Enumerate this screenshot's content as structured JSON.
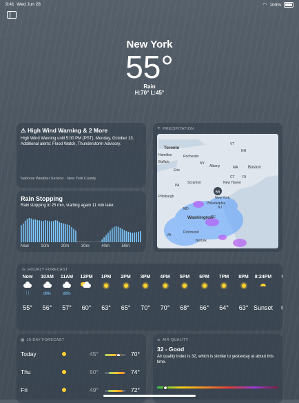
{
  "status": {
    "time": "9:41",
    "date": "Wed Jun 28",
    "battery": "100%"
  },
  "hero": {
    "city": "New York",
    "temp": "55°",
    "condition": "Rain",
    "hilo": "H:70°  L:45°"
  },
  "alert": {
    "title": "High Wind Warning & 2 More",
    "body": "High Wind Warning until 5:00 PM (PST), Monday, October 13. Additional alerts: Flood Watch, Thunderstorm Advisory.",
    "source": "National Weather Service · New York County",
    "icon": "warning-icon"
  },
  "rain": {
    "title": "Rain Stopping",
    "body": "Rain stopping in 25 min, starting again 11 min later.",
    "axis": [
      "Now",
      "10m",
      "20m",
      "30m",
      "40m",
      "50m"
    ],
    "intensity": [
      0.62,
      0.68,
      0.78,
      0.85,
      0.88,
      0.86,
      0.82,
      0.83,
      0.8,
      0.79,
      0.78,
      0.77,
      0.8,
      0.78,
      0.76,
      0.76,
      0.77,
      0.8,
      0.78,
      0.72,
      0.7,
      0.68,
      0.66,
      0.64,
      0.62,
      0.55,
      0.48,
      0.42,
      0,
      0,
      0,
      0,
      0,
      0,
      0,
      0,
      0,
      0,
      0,
      0,
      0.1,
      0.18,
      0.26,
      0.34,
      0.42,
      0.5,
      0.56,
      0.58,
      0.56,
      0.52,
      0.48,
      0.44,
      0.4,
      0.38,
      0.36,
      0.34,
      0.35,
      0.36,
      0.38,
      0.4
    ]
  },
  "precip": {
    "header": "PRECIPITATION",
    "current_temp": "55",
    "cities": [
      "Toronto",
      "Hamilton",
      "Rochester",
      "Buffalo",
      "Erie",
      "NY",
      "Albany",
      "MA",
      "Boston",
      "CT",
      "RI",
      "PA",
      "Scranton",
      "New Haven",
      "New York",
      "Pittsburgh",
      "Philadelphia",
      "MD",
      "Washington",
      "NJ",
      "DE",
      "Richmond",
      "Norfolk",
      "VA",
      "VT",
      "NH"
    ]
  },
  "hourly": {
    "header": "HOURLY FORECAST",
    "items": [
      {
        "time": "Now",
        "icon": "rain-cloud-icon",
        "pct": "",
        "temp": "55°"
      },
      {
        "time": "10AM",
        "icon": "rain-cloud-icon",
        "pct": "80%",
        "temp": "56°"
      },
      {
        "time": "11AM",
        "icon": "rain-cloud-icon",
        "pct": "80%",
        "temp": "57°"
      },
      {
        "time": "12PM",
        "icon": "partly-cloudy-icon",
        "pct": "",
        "temp": "60°"
      },
      {
        "time": "1PM",
        "icon": "sun-icon",
        "pct": "",
        "temp": "63°"
      },
      {
        "time": "2PM",
        "icon": "sun-icon",
        "pct": "",
        "temp": "65°"
      },
      {
        "time": "3PM",
        "icon": "sun-icon",
        "pct": "",
        "temp": "70°"
      },
      {
        "time": "4PM",
        "icon": "sun-icon",
        "pct": "",
        "temp": "70°"
      },
      {
        "time": "5PM",
        "icon": "sun-icon",
        "pct": "",
        "temp": "68°"
      },
      {
        "time": "6PM",
        "icon": "sun-icon",
        "pct": "",
        "temp": "66°"
      },
      {
        "time": "7PM",
        "icon": "sun-icon",
        "pct": "",
        "temp": "64°"
      },
      {
        "time": "8PM",
        "icon": "sun-icon",
        "pct": "",
        "temp": "63°"
      },
      {
        "time": "8:24PM",
        "icon": "sunset-icon",
        "pct": "",
        "temp": "Sunset"
      },
      {
        "time": "9",
        "icon": "moon-icon",
        "pct": "",
        "temp": "6"
      }
    ]
  },
  "forecast": {
    "header": "10-DAY FORECAST",
    "days": [
      {
        "day": "Today",
        "icon": "sun-icon",
        "lo": "45°",
        "hi": "70°",
        "lo_pos": 0.0,
        "hi_pos": 0.8,
        "current": 0.55
      },
      {
        "day": "Thu",
        "icon": "sun-icon",
        "lo": "50°",
        "hi": "74°",
        "lo_pos": 0.2,
        "hi_pos": 0.95
      },
      {
        "day": "Fri",
        "icon": "sun-icon",
        "lo": "49°",
        "hi": "72°",
        "lo_pos": 0.15,
        "hi_pos": 0.88
      }
    ]
  },
  "air": {
    "header": "AIR QUALITY",
    "title": "32 - Good",
    "body": "Air quality index is 32, which is similar to yesterday at about this time.",
    "level": 0.05
  }
}
